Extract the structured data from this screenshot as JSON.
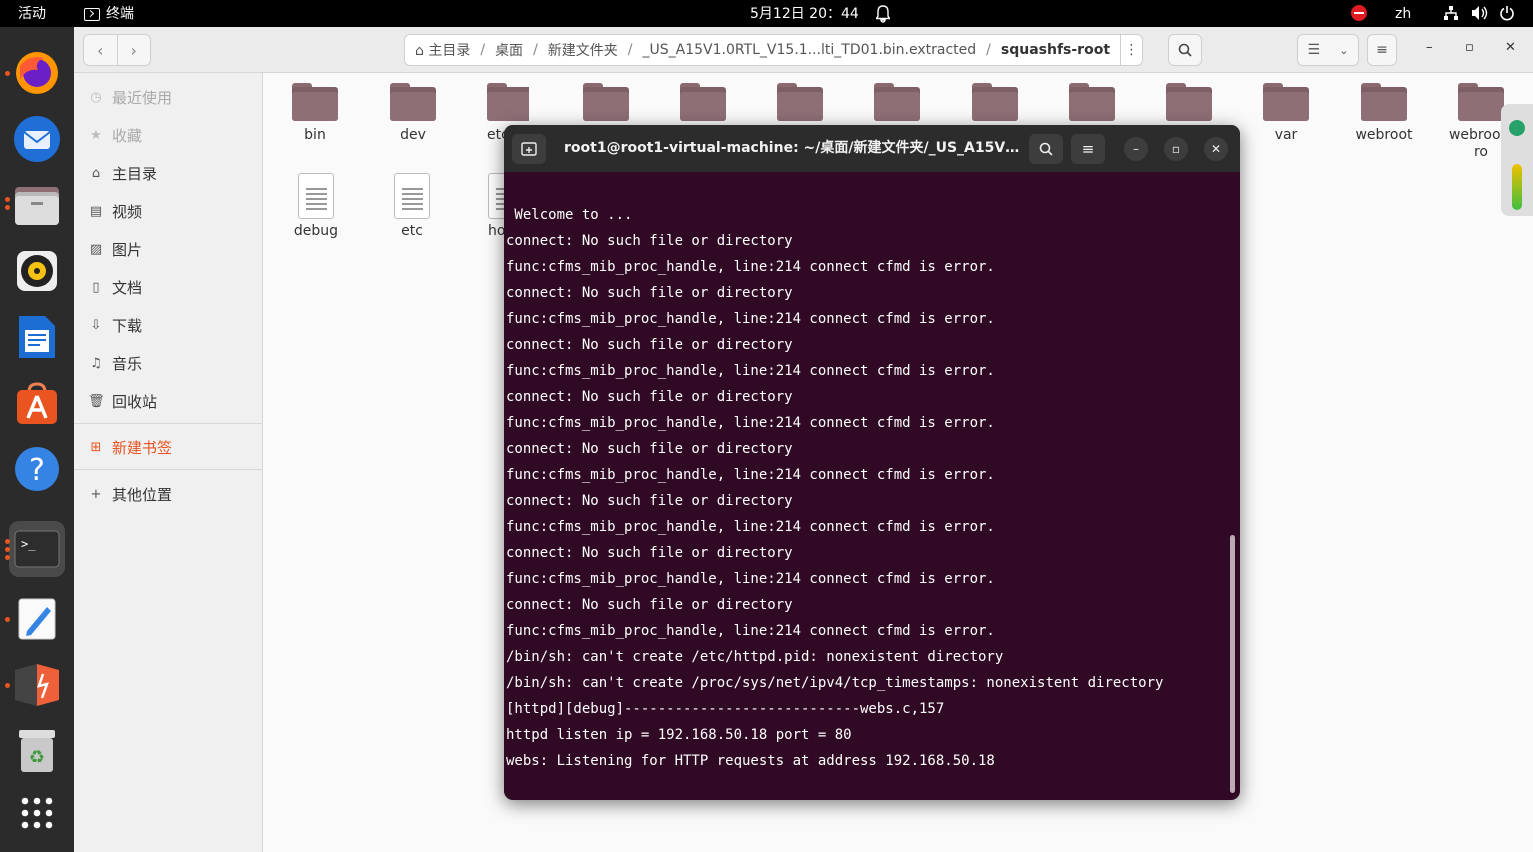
{
  "topbar": {
    "activities": "活动",
    "app_name": "终端",
    "clock": "5月12日 20：44",
    "lang": "zh",
    "icons": {
      "bell": "bell-icon",
      "dnd": "do-not-disturb-icon",
      "network": "network-icon",
      "volume": "volume-icon",
      "power": "power-icon"
    }
  },
  "dock": {
    "apps": [
      "firefox-icon",
      "thunderbird-icon",
      "files-icon",
      "rhythmbox-icon",
      "writer-icon",
      "software-icon",
      "help-icon",
      "terminal-icon",
      "text-editor-icon",
      "sublime-icon",
      "trash-icon",
      "app-grid-icon"
    ]
  },
  "files": {
    "path": [
      "主目录",
      "桌面",
      "新建文件夹",
      "_US_A15V1.0RTL_V15.1...lti_TD01.bin.extracted",
      "squashfs-root"
    ],
    "sidebar": {
      "recent": "最近使用",
      "starred": "收藏",
      "home": "主目录",
      "videos": "视频",
      "pictures": "图片",
      "documents": "文档",
      "downloads": "下载",
      "music": "音乐",
      "trash": "回收站",
      "new_bookmark": "新建书签",
      "other_locations": "其他位置"
    },
    "folders": [
      {
        "name": "bin"
      },
      {
        "name": "dev"
      },
      {
        "name": "etc"
      },
      {
        "name": ""
      },
      {
        "name": ""
      },
      {
        "name": ""
      },
      {
        "name": ""
      },
      {
        "name": ""
      },
      {
        "name": ""
      },
      {
        "name": ""
      },
      {
        "name": "var"
      },
      {
        "name": "webroot"
      },
      {
        "name": "webroot_\nro"
      }
    ],
    "docs": [
      {
        "name": "debug"
      },
      {
        "name": "etc"
      },
      {
        "name": "ho"
      }
    ]
  },
  "terminal": {
    "title": "root1@root1-virtual-machine: ~/桌面/新建文件夹/_US_A15V1....",
    "lines": [
      " Welcome to ...",
      "connect: No such file or directory",
      "func:cfms_mib_proc_handle, line:214 connect cfmd is error.",
      "connect: No such file or directory",
      "func:cfms_mib_proc_handle, line:214 connect cfmd is error.",
      "connect: No such file or directory",
      "func:cfms_mib_proc_handle, line:214 connect cfmd is error.",
      "connect: No such file or directory",
      "func:cfms_mib_proc_handle, line:214 connect cfmd is error.",
      "connect: No such file or directory",
      "func:cfms_mib_proc_handle, line:214 connect cfmd is error.",
      "connect: No such file or directory",
      "func:cfms_mib_proc_handle, line:214 connect cfmd is error.",
      "connect: No such file or directory",
      "func:cfms_mib_proc_handle, line:214 connect cfmd is error.",
      "connect: No such file or directory",
      "func:cfms_mib_proc_handle, line:214 connect cfmd is error.",
      "/bin/sh: can't create /etc/httpd.pid: nonexistent directory",
      "/bin/sh: can't create /proc/sys/net/ipv4/tcp_timestamps: nonexistent directory",
      "[httpd][debug]----------------------------webs.c,157",
      "httpd listen ip = 192.168.50.18 port = 80",
      "webs: Listening for HTTP requests at address 192.168.50.18"
    ]
  },
  "colors": {
    "accent": "#e95420",
    "terminal_bg": "#300a24",
    "folder": "#7f5f66"
  }
}
